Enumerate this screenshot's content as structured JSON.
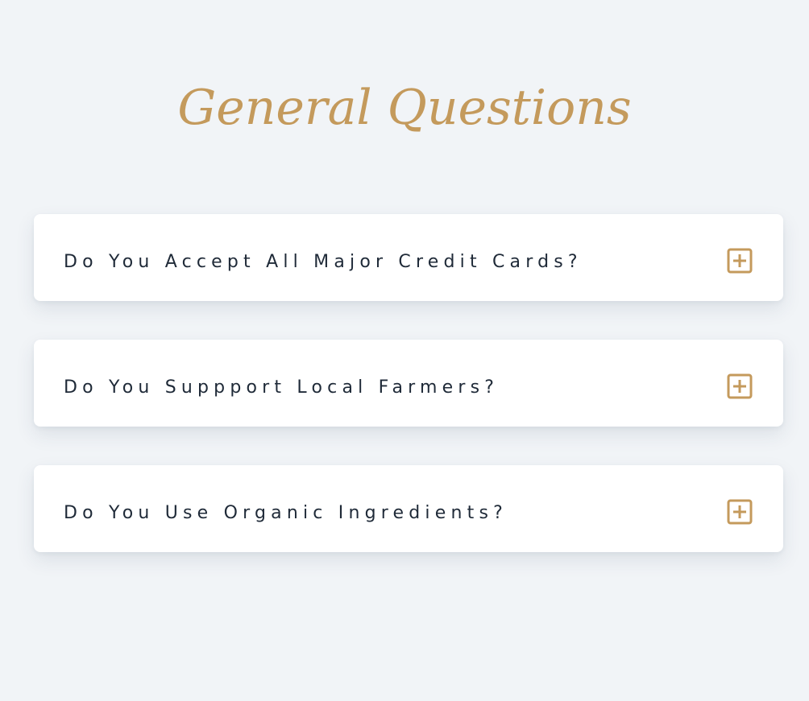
{
  "page": {
    "title": "General Questions"
  },
  "colors": {
    "accent": "#c49a5c",
    "background": "#f1f4f7",
    "card": "#ffffff",
    "text": "#1f2a38"
  },
  "faq": {
    "items": [
      {
        "question": "Do You Accept All Major Credit Cards?",
        "icon": "plus-square-icon",
        "expanded": false
      },
      {
        "question": "Do You Suppport Local Farmers?",
        "icon": "plus-square-icon",
        "expanded": false
      },
      {
        "question": "Do You Use Organic Ingredients?",
        "icon": "plus-square-icon",
        "expanded": false
      }
    ]
  }
}
